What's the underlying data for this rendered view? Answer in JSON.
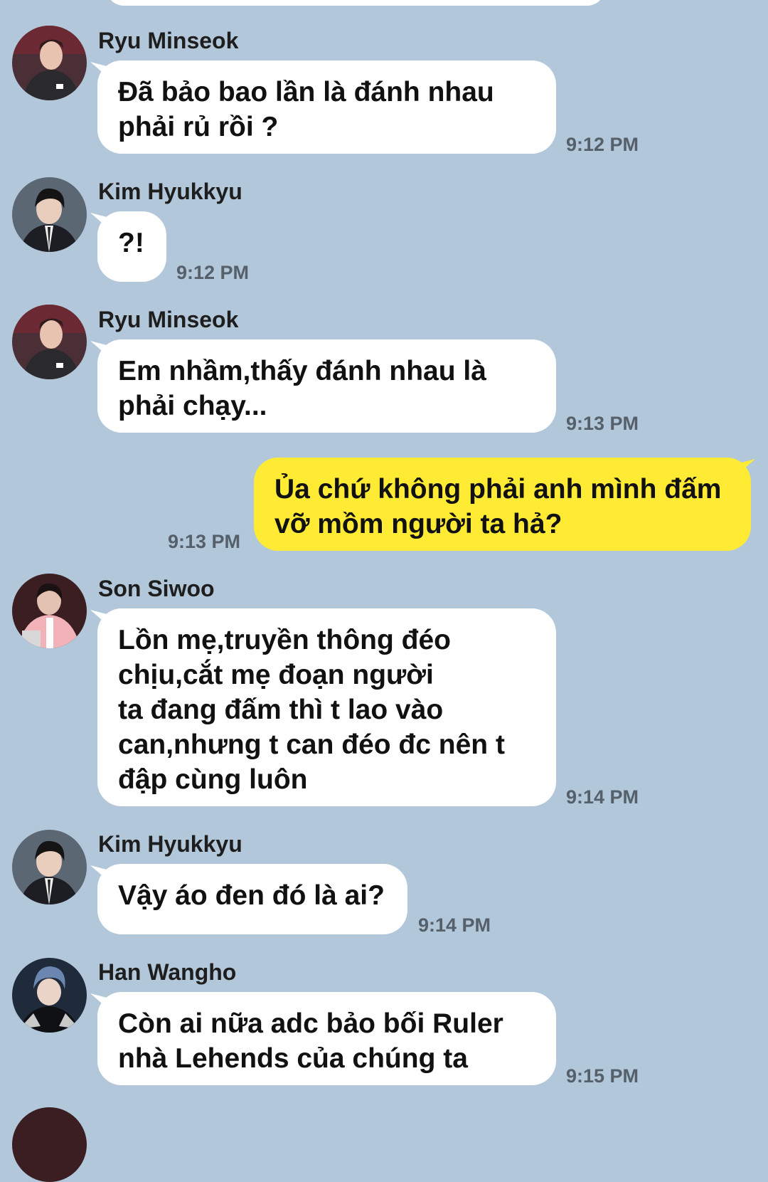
{
  "messages": [
    {
      "sender": "Ryu Minseok",
      "text": "Đã bảo bao lần là đánh nhau\nphải rủ rồi ?",
      "time": "9:12 PM",
      "avatar": "person-avatar-ryu-minseok"
    },
    {
      "sender": "Kim Hyukkyu",
      "text": "?!",
      "time": "9:12 PM",
      "avatar": "person-avatar-kim-hyukkyu"
    },
    {
      "sender": "Ryu Minseok",
      "text": "Em nhầm,thấy đánh nhau là\nphải chạy...",
      "time": "9:13 PM",
      "avatar": "person-avatar-ryu-minseok"
    },
    {
      "sender": "",
      "text": "Ủa chứ không phải anh mình đấm\nvỡ mồm người ta hả?",
      "time": "9:13 PM",
      "outgoing": true
    },
    {
      "sender": "Son Siwoo",
      "text": "Lồn mẹ,truyền thông đéo\nchịu,cắt mẹ đoạn người\nta đang đấm thì t lao vào\ncan,nhưng t can đéo đc nên t\nđập cùng luôn",
      "time": "9:14 PM",
      "avatar": "person-avatar-son-siwoo"
    },
    {
      "sender": "Kim Hyukkyu",
      "text": "Vậy áo đen đó là ai?",
      "time": "9:14 PM",
      "avatar": "person-avatar-kim-hyukkyu"
    },
    {
      "sender": "Han Wangho",
      "text": "Còn ai nữa adc bảo bối Ruler\nnhà Lehends của chúng ta",
      "time": "9:15 PM",
      "avatar": "person-avatar-han-wangho"
    }
  ],
  "colors": {
    "background": "#b2c7d9",
    "incoming_bubble": "#ffffff",
    "outgoing_bubble": "#ffeb33"
  }
}
